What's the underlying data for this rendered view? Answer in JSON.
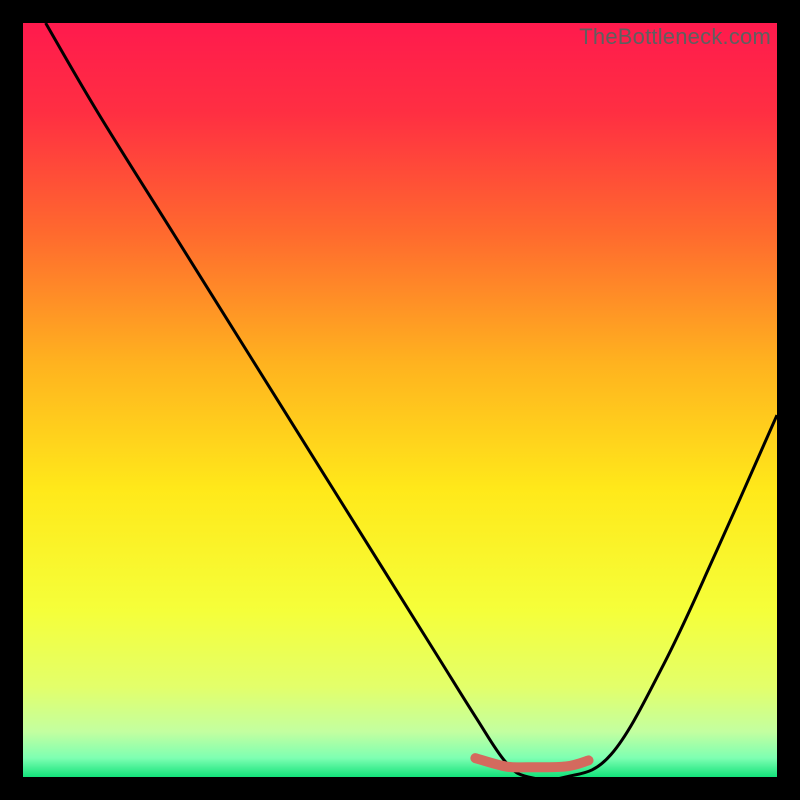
{
  "watermark": "TheBottleneck.com",
  "colors": {
    "gradient_stops": [
      {
        "offset": 0.0,
        "color": "#ff1a4d"
      },
      {
        "offset": 0.12,
        "color": "#ff2f42"
      },
      {
        "offset": 0.28,
        "color": "#ff6a2e"
      },
      {
        "offset": 0.45,
        "color": "#ffb21f"
      },
      {
        "offset": 0.62,
        "color": "#ffe91a"
      },
      {
        "offset": 0.78,
        "color": "#f5ff3a"
      },
      {
        "offset": 0.88,
        "color": "#e3ff6a"
      },
      {
        "offset": 0.94,
        "color": "#c3ffa0"
      },
      {
        "offset": 0.975,
        "color": "#7dffb2"
      },
      {
        "offset": 1.0,
        "color": "#13e27a"
      }
    ],
    "curve": "#000000",
    "segment": "#d46a5e",
    "frame": "#000000"
  },
  "chart_data": {
    "type": "line",
    "title": "",
    "xlabel": "",
    "ylabel": "",
    "xlim": [
      0,
      100
    ],
    "ylim": [
      0,
      100
    ],
    "series": [
      {
        "name": "bottleneck-curve",
        "x": [
          3,
          10,
          20,
          30,
          40,
          50,
          55,
          60,
          64,
          67,
          72,
          78,
          85,
          92,
          100
        ],
        "y": [
          100,
          88,
          72,
          56,
          40,
          24,
          16,
          8,
          2,
          0,
          0,
          3,
          15,
          30,
          48
        ]
      }
    ],
    "highlight_segment": {
      "x": [
        60,
        64,
        67,
        72,
        75
      ],
      "y": [
        2.5,
        1.4,
        1.3,
        1.4,
        2.2
      ]
    }
  }
}
